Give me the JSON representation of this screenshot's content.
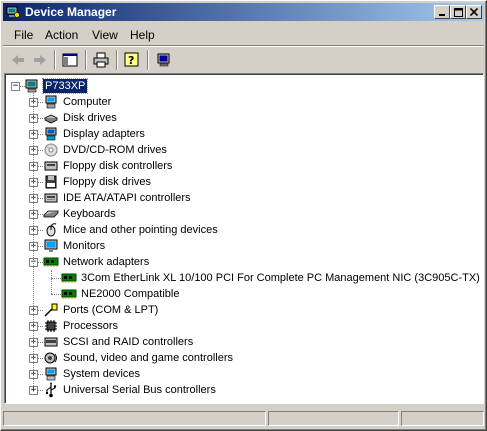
{
  "window": {
    "title": "Device Manager",
    "controls": {
      "minimize": "_",
      "maximize": "□",
      "close": "×"
    }
  },
  "menu": {
    "items": [
      "File",
      "Action",
      "View",
      "Help"
    ]
  },
  "toolbar": {
    "buttons": [
      "back-icon",
      "forward-icon",
      "show-hide-console-tree-icon",
      "print-icon",
      "help-icon",
      "computer-properties-icon"
    ]
  },
  "tree": {
    "root": {
      "label": "P733XP",
      "expanded": true,
      "selected": true
    },
    "categories": [
      {
        "label": "Computer",
        "icon": "computer-icon",
        "expanded": false
      },
      {
        "label": "Disk drives",
        "icon": "disk-drive-icon",
        "expanded": false
      },
      {
        "label": "Display adapters",
        "icon": "display-adapter-icon",
        "expanded": false
      },
      {
        "label": "DVD/CD-ROM drives",
        "icon": "cdrom-icon",
        "expanded": false
      },
      {
        "label": "Floppy disk controllers",
        "icon": "floppy-controller-icon",
        "expanded": false
      },
      {
        "label": "Floppy disk drives",
        "icon": "floppy-drive-icon",
        "expanded": false
      },
      {
        "label": "IDE ATA/ATAPI controllers",
        "icon": "ide-controller-icon",
        "expanded": false
      },
      {
        "label": "Keyboards",
        "icon": "keyboard-icon",
        "expanded": false
      },
      {
        "label": "Mice and other pointing devices",
        "icon": "mouse-icon",
        "expanded": false
      },
      {
        "label": "Monitors",
        "icon": "monitor-icon",
        "expanded": false
      },
      {
        "label": "Network adapters",
        "icon": "network-adapter-icon",
        "expanded": true,
        "children": [
          {
            "label": "3Com EtherLink XL 10/100 PCI For Complete PC Management NIC (3C905C-TX)",
            "icon": "network-card-icon"
          },
          {
            "label": "NE2000 Compatible",
            "icon": "network-card-icon"
          }
        ]
      },
      {
        "label": "Ports (COM & LPT)",
        "icon": "port-icon",
        "expanded": false
      },
      {
        "label": "Processors",
        "icon": "processor-icon",
        "expanded": false
      },
      {
        "label": "SCSI and RAID controllers",
        "icon": "scsi-icon",
        "expanded": false
      },
      {
        "label": "Sound, video and game controllers",
        "icon": "sound-icon",
        "expanded": false
      },
      {
        "label": "System devices",
        "icon": "system-device-icon",
        "expanded": false
      },
      {
        "label": "Universal Serial Bus controllers",
        "icon": "usb-icon",
        "expanded": false
      }
    ]
  },
  "colors": {
    "title_gradient_start": "#0a246a",
    "title_gradient_end": "#a6caf0",
    "selection": "#0a246a",
    "face": "#d4d0c8"
  }
}
